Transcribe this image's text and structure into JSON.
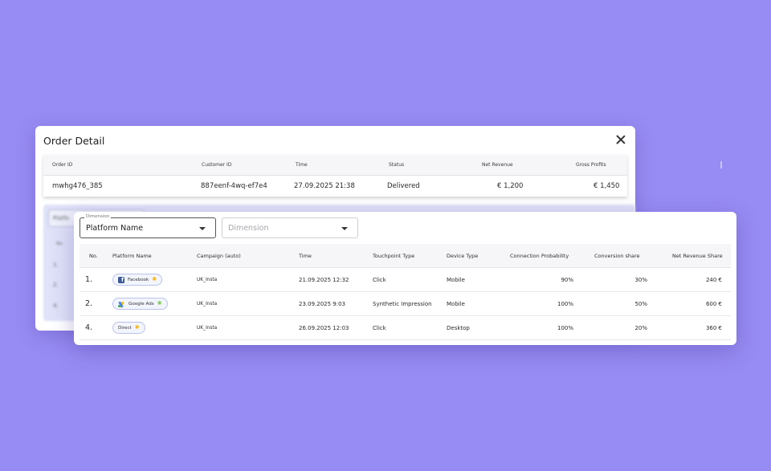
{
  "order_detail": {
    "title": "Order Detail",
    "close_icon": "close-icon",
    "columns": [
      "Order ID",
      "Customer ID",
      "Time",
      "Status",
      "Net Revenue",
      "Gross Profits"
    ],
    "row": {
      "order_id": "mwhg476_385",
      "customer_id": "887eenf-4wq-ef7e4",
      "time": "27.09.2025 21:38",
      "status": "Delivered",
      "net_revenue": "€ 1,200",
      "gross_profits": "€ 1,450"
    },
    "blurred": {
      "filter_label": "Platfo",
      "no_header": "No.",
      "rows": [
        "1.",
        "2.",
        "4."
      ]
    }
  },
  "attribution": {
    "dimension_1": {
      "legend": "Dimension",
      "value": "Platform Name",
      "icon": "chevron-down-icon"
    },
    "dimension_2": {
      "placeholder": "Dimension",
      "icon": "chevron-down-icon"
    },
    "columns": [
      "No.",
      "Platform Name",
      "Campaign (auto)",
      "Time",
      "Touchpoint Type",
      "Device Type",
      "Connection Probability",
      "Conversion share",
      "Net Revenue Share"
    ],
    "rows": [
      {
        "no": "1.",
        "platform": "Facebook",
        "platform_icon": "facebook-icon",
        "sparkle_icon": "sparkle-icon",
        "campaign": "UK_Insta",
        "time": "21.09.2025 12:32",
        "touchpoint": "Click",
        "device": "Mobile",
        "probability": "90%",
        "conversion_share": "30%",
        "revenue_share": "240 €"
      },
      {
        "no": "2.",
        "platform": "Google Ads",
        "platform_icon": "google-ads-icon",
        "sparkle_icon": "sparkle-icon",
        "campaign": "UK_Insta",
        "time": "23.09.2025 9:03",
        "touchpoint": "Synthetic Impression",
        "device": "Mobile",
        "probability": "100%",
        "conversion_share": "50%",
        "revenue_share": "600 €"
      },
      {
        "no": "4.",
        "platform": "Direct",
        "platform_icon": null,
        "sparkle_icon": "sparkle-icon",
        "campaign": "UK_Insta",
        "time": "26.09.2025 12:03",
        "touchpoint": "Click",
        "device": "Desktop",
        "probability": "100%",
        "conversion_share": "20%",
        "revenue_share": "360 €"
      }
    ]
  },
  "colors": {
    "background": "#978cf3",
    "panel": "#ffffff",
    "table_header": "#f6f6f8",
    "chip_border": "#b9c2e8",
    "facebook": "#3b5998",
    "sparkle_yellow": "#f5b400",
    "sparkle_green": "#7cc94f"
  }
}
